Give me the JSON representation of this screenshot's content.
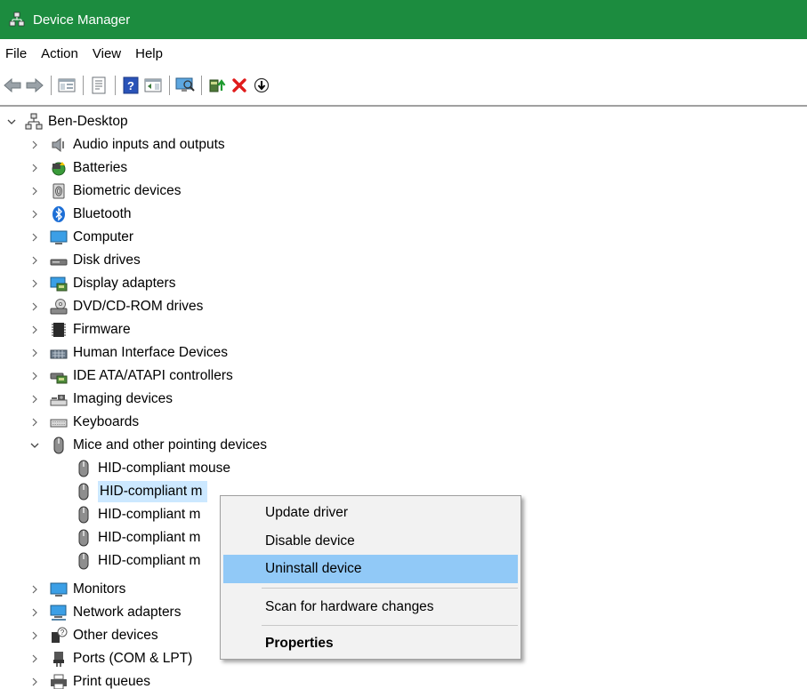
{
  "window": {
    "title": "Device Manager",
    "accent": "#1c8c3f"
  },
  "menu": [
    "File",
    "Action",
    "View",
    "Help"
  ],
  "toolbar": {
    "buttons": [
      "back-arrow-icon",
      "forward-arrow-icon",
      "show-hide-console-tree-icon",
      "properties-icon",
      "help-icon",
      "action-pane-icon",
      "scan-hardware-icon",
      "update-driver-icon",
      "uninstall-x-icon",
      "disable-device-icon"
    ]
  },
  "tree": {
    "root": "Ben-Desktop",
    "categories": [
      "Audio inputs and outputs",
      "Batteries",
      "Biometric devices",
      "Bluetooth",
      "Computer",
      "Disk drives",
      "Display adapters",
      "DVD/CD-ROM drives",
      "Firmware",
      "Human Interface Devices",
      "IDE ATA/ATAPI controllers",
      "Imaging devices",
      "Keyboards",
      "Mice and other pointing devices",
      "Monitors",
      "Network adapters",
      "Other devices",
      "Ports (COM & LPT)",
      "Print queues"
    ],
    "mice_children": [
      "HID-compliant mouse",
      "HID-compliant m",
      "HID-compliant m",
      "HID-compliant m",
      "HID-compliant m"
    ],
    "selection_color": "#cce8ff"
  },
  "context_menu": {
    "items": [
      "Update driver",
      "Disable device",
      "Uninstall device",
      "Scan for hardware changes",
      "Properties"
    ],
    "highlighted": "Uninstall device",
    "highlight_color": "#91c9f7"
  }
}
